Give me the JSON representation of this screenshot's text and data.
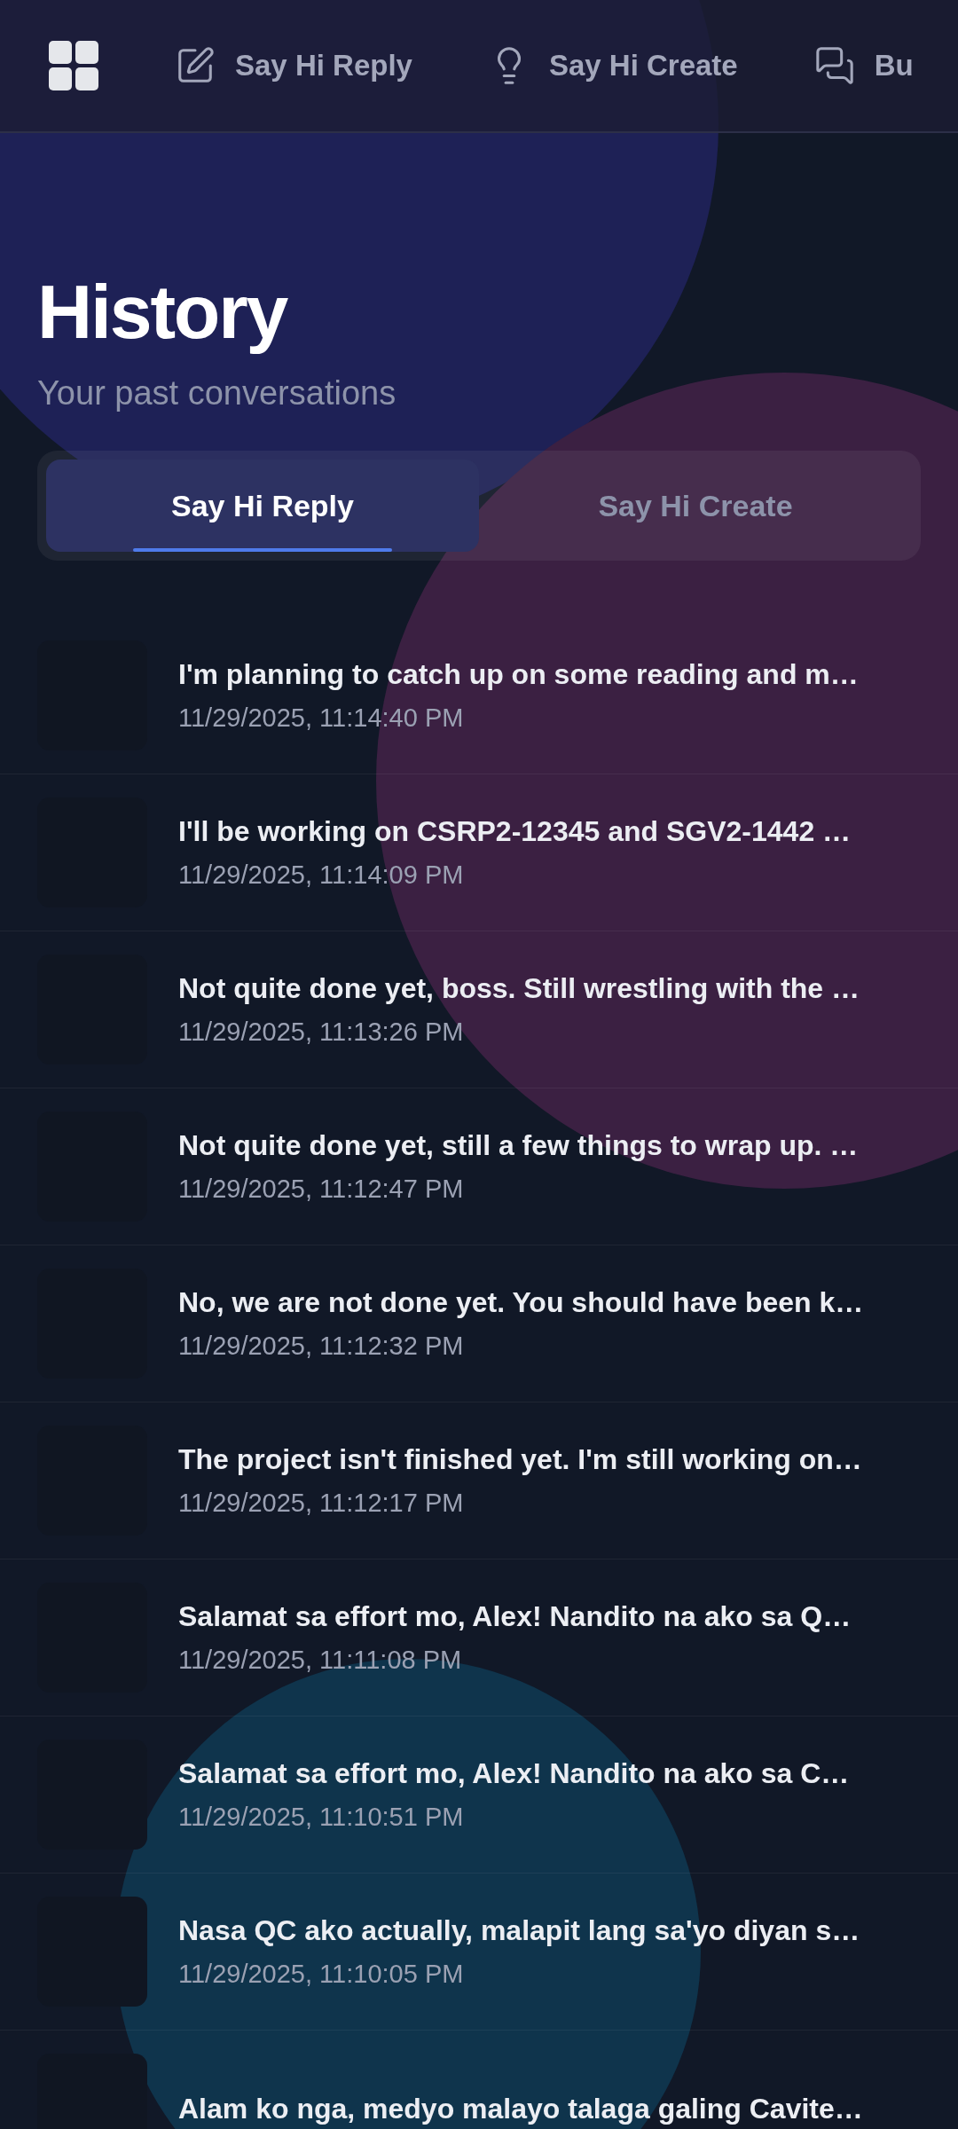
{
  "nav": {
    "items": [
      {
        "label": "Say Hi Reply"
      },
      {
        "label": "Say Hi Create"
      },
      {
        "label": "Bu"
      }
    ]
  },
  "header": {
    "title": "History",
    "subtitle": "Your past conversations"
  },
  "tabs": [
    {
      "label": "Say Hi Reply",
      "selected": true
    },
    {
      "label": "Say Hi Create",
      "selected": false
    }
  ],
  "conversations": [
    {
      "title": "I'm planning to catch up on some reading and m…",
      "time": "11/29/2025, 11:14:40 PM"
    },
    {
      "title": "I'll be working on CSRP2-12345 and SGV2-1442 …",
      "time": "11/29/2025, 11:14:09 PM"
    },
    {
      "title": "Not quite done yet, boss. Still wrestling with the …",
      "time": "11/29/2025, 11:13:26 PM"
    },
    {
      "title": "Not quite done yet, still a few things to wrap up. …",
      "time": "11/29/2025, 11:12:47 PM"
    },
    {
      "title": "No, we are not done yet. You should have been k…",
      "time": "11/29/2025, 11:12:32 PM"
    },
    {
      "title": "The project isn't finished yet. I'm still working on…",
      "time": "11/29/2025, 11:12:17 PM"
    },
    {
      "title": "Salamat sa effort mo, Alex! Nandito na ako sa Q…",
      "time": "11/29/2025, 11:11:08 PM"
    },
    {
      "title": "Salamat sa effort mo, Alex! Nandito na ako sa C…",
      "time": "11/29/2025, 11:10:51 PM"
    },
    {
      "title": "Nasa QC ako actually, malapit lang sa'yo diyan s…",
      "time": "11/29/2025, 11:10:05 PM"
    },
    {
      "title": "Alam ko nga, medyo malayo talaga galing Cavite…"
    }
  ]
}
